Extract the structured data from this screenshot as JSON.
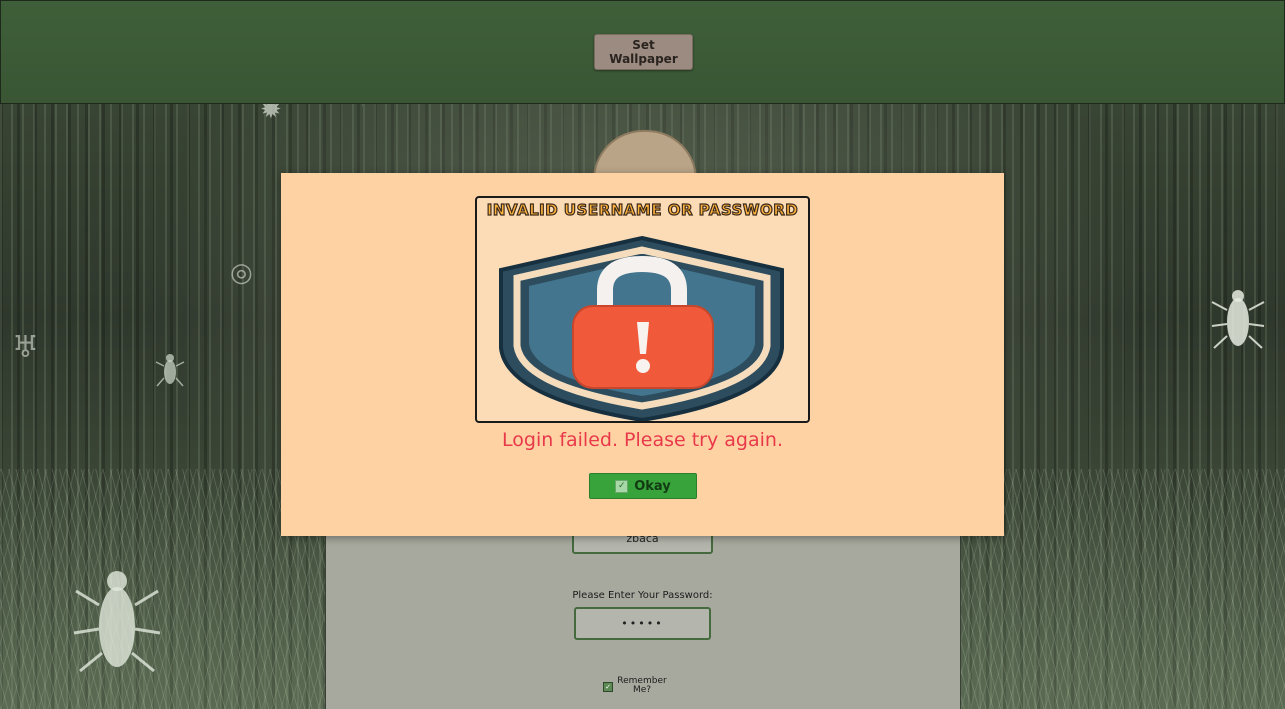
{
  "topbar": {
    "set_wallpaper_label": "Set Wallpaper"
  },
  "login_form": {
    "username_value": "zbaca",
    "password_label": "Please Enter Your Password:",
    "password_value": "•••••",
    "remember_label": "Remember Me?",
    "remember_checked": true
  },
  "modal": {
    "image_title": "INVALID USERNAME OR PASSWORD",
    "message": "Login failed. Please try again.",
    "okay_label": "Okay",
    "okay_icon": "check-icon"
  },
  "colors": {
    "topbar": "#3e5f39",
    "modal_bg": "#ffd2a4",
    "message": "#e8394a",
    "okay_button": "#38a33a",
    "lock_body": "#f05a3a",
    "shield": "#2f5468"
  }
}
